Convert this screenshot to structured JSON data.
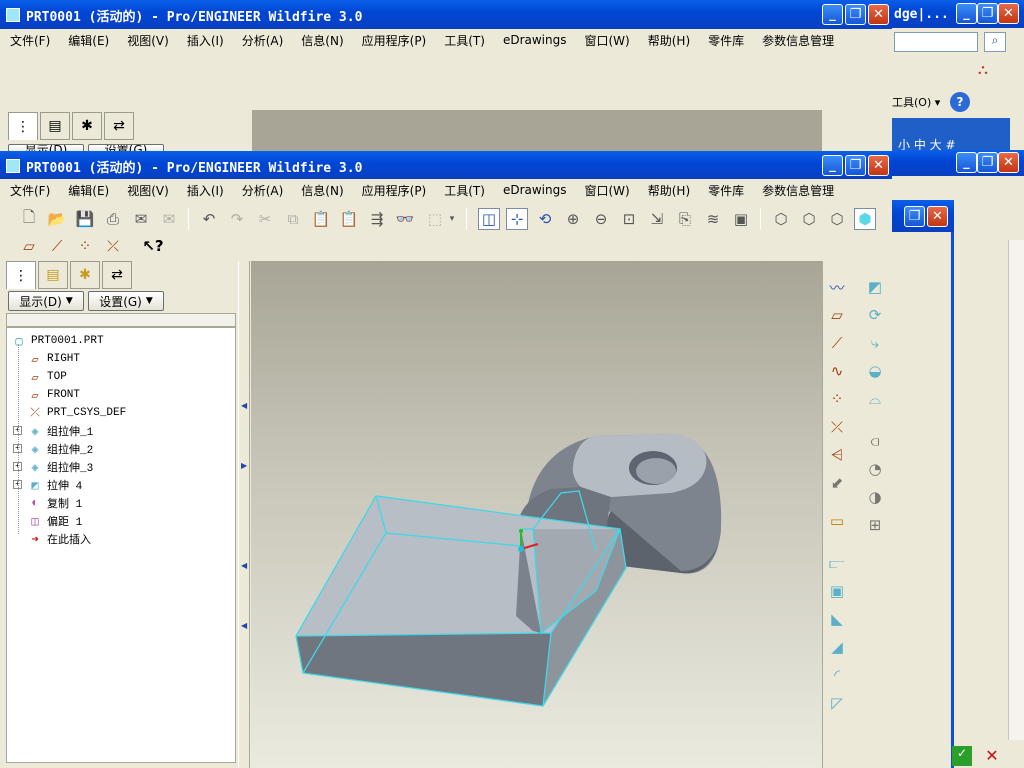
{
  "window_title": "PRT0001 (活动的) - Pro/ENGINEER Wildfire 3.0",
  "background_window": {
    "title_fragment": "dge|...",
    "toolbar_tools_label": "工具(O)",
    "partial_tab_text": "小 中 大",
    "partial_tab_hash": "#"
  },
  "menu": [
    "文件(F)",
    "编辑(E)",
    "视图(V)",
    "插入(I)",
    "分析(A)",
    "信息(N)",
    "应用程序(P)",
    "工具(T)",
    "eDrawings",
    "窗口(W)",
    "帮助(H)",
    "零件库",
    "参数信息管理"
  ],
  "panel": {
    "display_button": "显示(D)",
    "settings_button": "设置(G)",
    "back_display_button": "显示(D)",
    "back_settings_button": "设置(G)"
  },
  "model_tree": [
    {
      "label": "PRT0001.PRT",
      "icon": "part-icon",
      "level": 0
    },
    {
      "label": "RIGHT",
      "icon": "datum-plane-icon",
      "level": 1
    },
    {
      "label": "TOP",
      "icon": "datum-plane-icon",
      "level": 1
    },
    {
      "label": "FRONT",
      "icon": "datum-plane-icon",
      "level": 1
    },
    {
      "label": "PRT_CSYS_DEF",
      "icon": "csys-icon",
      "level": 1
    },
    {
      "label": "组拉伸_1",
      "icon": "group-icon",
      "level": 1,
      "expandable": true
    },
    {
      "label": "组拉伸_2",
      "icon": "group-icon",
      "level": 1,
      "expandable": true
    },
    {
      "label": "组拉伸_3",
      "icon": "group-icon",
      "level": 1,
      "expandable": true
    },
    {
      "label": "拉伸 4",
      "icon": "extrude-icon",
      "level": 1,
      "expandable": true
    },
    {
      "label": "复制 1",
      "icon": "copy-icon",
      "level": 1
    },
    {
      "label": "偏距 1",
      "icon": "offset-icon",
      "level": 1
    },
    {
      "label": "在此插入",
      "icon": "insert-arrow-icon",
      "level": 1
    }
  ],
  "colors": {
    "title_blue": "#0a5fe8",
    "chrome": "#ece9d8",
    "selection_edge": "#3fd8e8",
    "insert_arrow": "#d01010",
    "model_shadow": "#5c636c"
  }
}
